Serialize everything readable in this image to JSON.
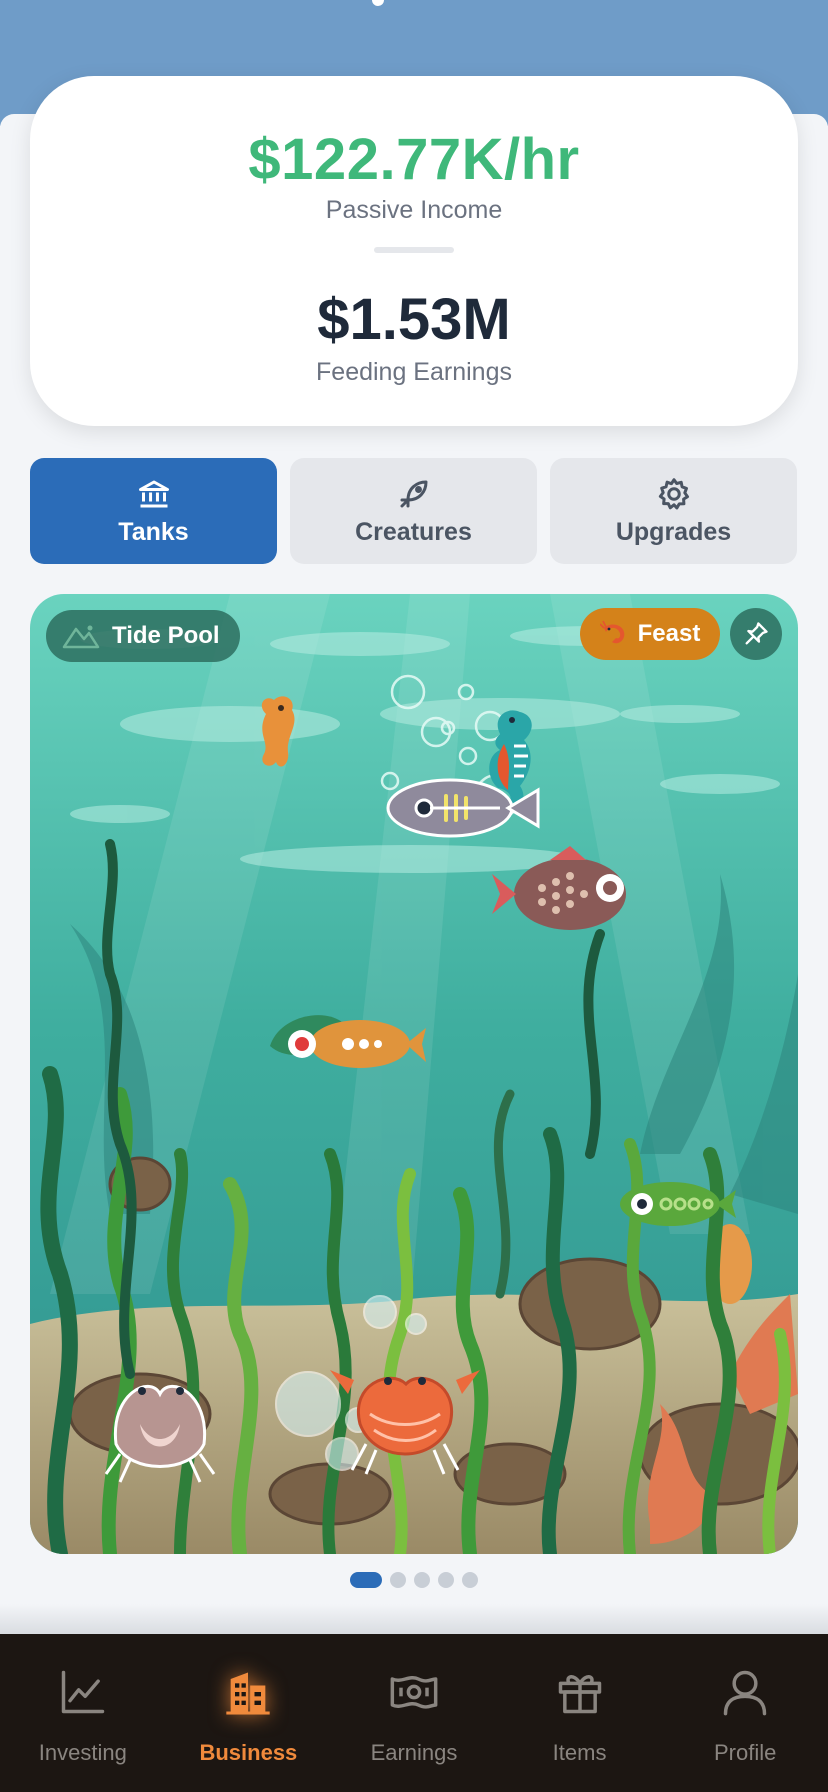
{
  "header": {
    "passive_income_value": "$122.77K/hr",
    "passive_income_label": "Passive Income",
    "feeding_earnings_value": "$1.53M",
    "feeding_earnings_label": "Feeding Earnings"
  },
  "tabs": [
    {
      "label": "Tanks",
      "icon": "bank-icon",
      "active": true
    },
    {
      "label": "Creatures",
      "icon": "leaf-fish-icon",
      "active": false
    },
    {
      "label": "Upgrades",
      "icon": "gear-icon",
      "active": false
    }
  ],
  "tank": {
    "name": "Tide Pool",
    "name_icon": "mountain-icon",
    "feast_label": "Feast",
    "feast_icon": "shrimp-icon",
    "pin_icon": "pin-icon"
  },
  "pager": {
    "count": 5,
    "active_index": 0
  },
  "bottom_nav": [
    {
      "label": "Investing",
      "icon": "chart-icon",
      "active": false
    },
    {
      "label": "Business",
      "icon": "buildings-icon",
      "active": true
    },
    {
      "label": "Earnings",
      "icon": "money-icon",
      "active": false
    },
    {
      "label": "Items",
      "icon": "gift-icon",
      "active": false
    },
    {
      "label": "Profile",
      "icon": "user-icon",
      "active": false
    }
  ],
  "colors": {
    "passive_green": "#3fb87a",
    "primary_blue": "#2b6cb8",
    "nav_active_orange": "#f08a3c",
    "feast_orange": "#d4821a",
    "water_top": "#6ad3bf",
    "water_bottom": "#2e8f8d"
  }
}
